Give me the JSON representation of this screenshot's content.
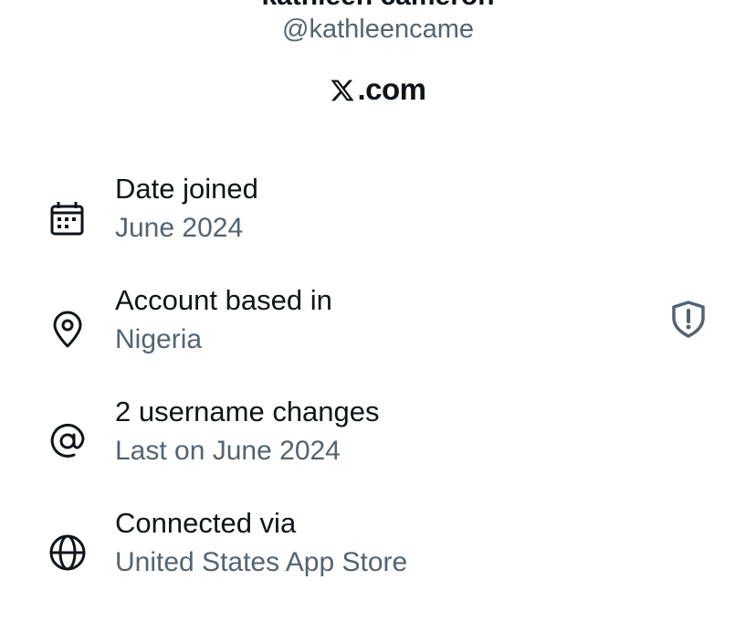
{
  "profile": {
    "display_name": "kathleen cameron",
    "handle": "@kathleencame",
    "platform": ".com"
  },
  "details": [
    {
      "label": "Date joined",
      "value": "June 2024",
      "icon": "calendar-icon"
    },
    {
      "label": "Account based in",
      "value": "Nigeria",
      "icon": "location-pin-icon",
      "side_icon": "shield-alert-icon"
    },
    {
      "label": "2 username changes",
      "value": "Last on June 2024",
      "icon": "at-sign-icon"
    },
    {
      "label": "Connected via",
      "value": "United States App Store",
      "icon": "globe-icon"
    }
  ],
  "colors": {
    "text_primary": "#0f1419",
    "text_secondary": "#536471",
    "shield_icon": "#536471"
  }
}
